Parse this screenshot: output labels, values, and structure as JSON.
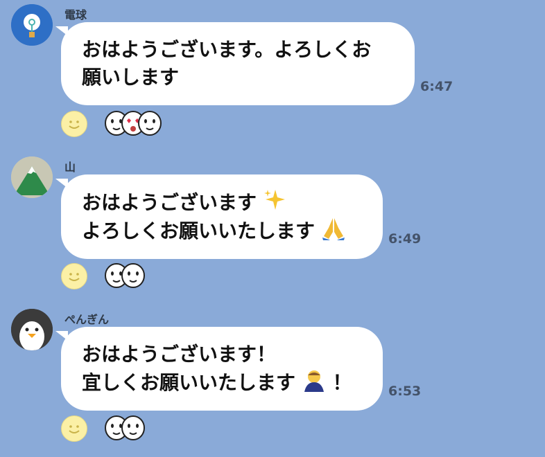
{
  "colors": {
    "background": "#8aaad8",
    "bubble": "#ffffff",
    "timestamp": "#44536a",
    "sender_name": "#2f3a48",
    "reaction_button": "#fbf0a6"
  },
  "messages": [
    {
      "sender": "電球",
      "avatar_icon": "lightbulb-icon",
      "lines": [
        "おはようございます。よろしくお",
        "願いします"
      ],
      "time": "6:47",
      "reactions": [
        "face-sticker",
        "heart-eyes-face-sticker",
        "face-sticker"
      ]
    },
    {
      "sender": "山",
      "avatar_icon": "mountain-icon",
      "lines": [
        "おはようございます",
        "よろしくお願いいたします"
      ],
      "line_emojis": [
        "sparkles-emoji",
        "folded-hands-emoji"
      ],
      "time": "6:49",
      "reactions": [
        "face-sticker",
        "face-sticker"
      ]
    },
    {
      "sender": "ぺんぎん",
      "avatar_icon": "penguin-icon",
      "lines": [
        "おはようございます！",
        "宜しくお願いいたします"
      ],
      "line2_suffix": "！",
      "line_emojis": [
        "bowing-person-emoji"
      ],
      "time": "6:53",
      "reactions": [
        "face-sticker",
        "face-sticker"
      ]
    }
  ]
}
